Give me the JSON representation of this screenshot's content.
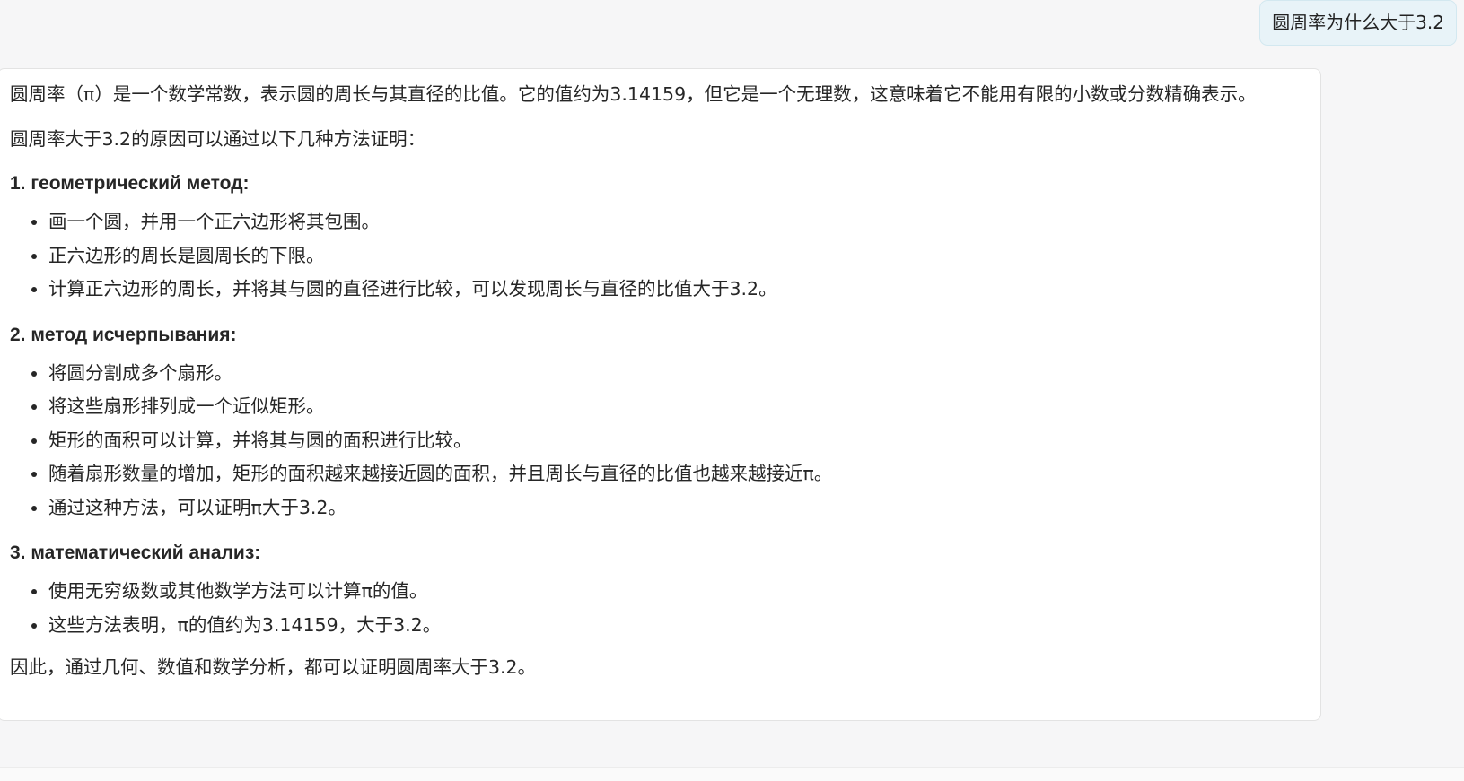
{
  "user_message": "圆周率为什么大于3.2",
  "assistant": {
    "intro": "圆周率（π）是一个数学常数，表示圆的周长与其直径的比值。它的值约为3.14159，但它是一个无理数，这意味着它不能用有限的小数或分数精确表示。",
    "lead": "圆周率大于3.2的原因可以通过以下几种方法证明：",
    "sections": [
      {
        "heading": "1. геометрический метод:",
        "items": [
          "画一个圆，并用一个正六边形将其包围。",
          "正六边形的周长是圆周长的下限。",
          "计算正六边形的周长，并将其与圆的直径进行比较，可以发现周长与直径的比值大于3.2。"
        ]
      },
      {
        "heading": "2. метод исчерпывания:",
        "items": [
          "将圆分割成多个扇形。",
          "将这些扇形排列成一个近似矩形。",
          "矩形的面积可以计算，并将其与圆的面积进行比较。",
          "随着扇形数量的增加，矩形的面积越来越接近圆的面积，并且周长与直径的比值也越来越接近π。",
          "通过这种方法，可以证明π大于3.2。"
        ]
      },
      {
        "heading": "3. математический анализ:",
        "items": [
          "使用无穷级数或其他数学方法可以计算π的值。",
          "这些方法表明，π的值约为3.14159，大于3.2。"
        ]
      }
    ],
    "conclusion": "因此，通过几何、数值和数学分析，都可以证明圆周率大于3.2。"
  }
}
